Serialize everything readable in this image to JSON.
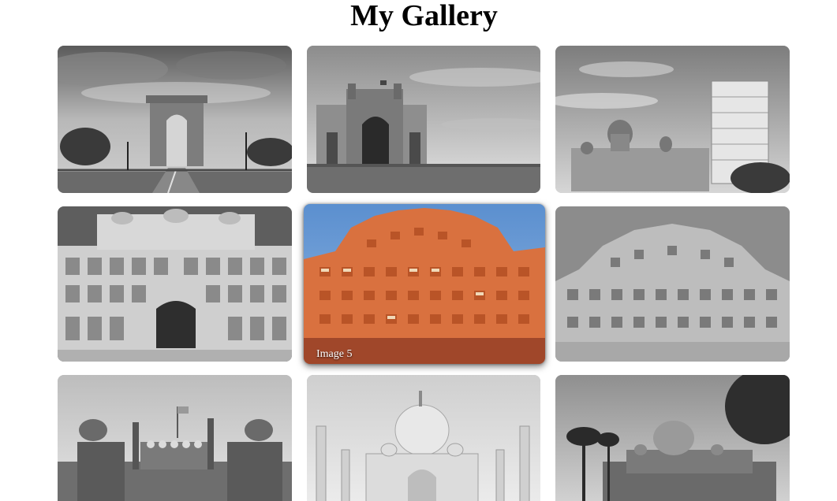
{
  "page": {
    "title": "My Gallery"
  },
  "gallery": {
    "images": [
      {
        "subject": "India Gate",
        "style": "grayscale",
        "icon": "image-thumbnail"
      },
      {
        "subject": "Gateway of India",
        "style": "grayscale",
        "icon": "image-thumbnail"
      },
      {
        "subject": "Taj Mahal Palace Hotel",
        "style": "grayscale",
        "icon": "image-thumbnail"
      },
      {
        "subject": "City Palace",
        "style": "grayscale",
        "icon": "image-thumbnail"
      },
      {
        "subject": "Hawa Mahal",
        "style": "color",
        "hovered": true,
        "caption": "Image 5",
        "icon": "image-thumbnail"
      },
      {
        "subject": "Hawa Mahal",
        "style": "grayscale",
        "icon": "image-thumbnail"
      },
      {
        "subject": "Red Fort",
        "style": "grayscale",
        "icon": "image-thumbnail"
      },
      {
        "subject": "Taj Mahal",
        "style": "grayscale",
        "icon": "image-thumbnail"
      },
      {
        "subject": "Humayun's Tomb",
        "style": "grayscale",
        "icon": "image-thumbnail"
      }
    ]
  },
  "colors": {
    "background": "#ffffff",
    "title": "#000000",
    "caption": "#ffffff",
    "sky_color": "#6f9fd6",
    "facade_color": "#d9713f"
  }
}
